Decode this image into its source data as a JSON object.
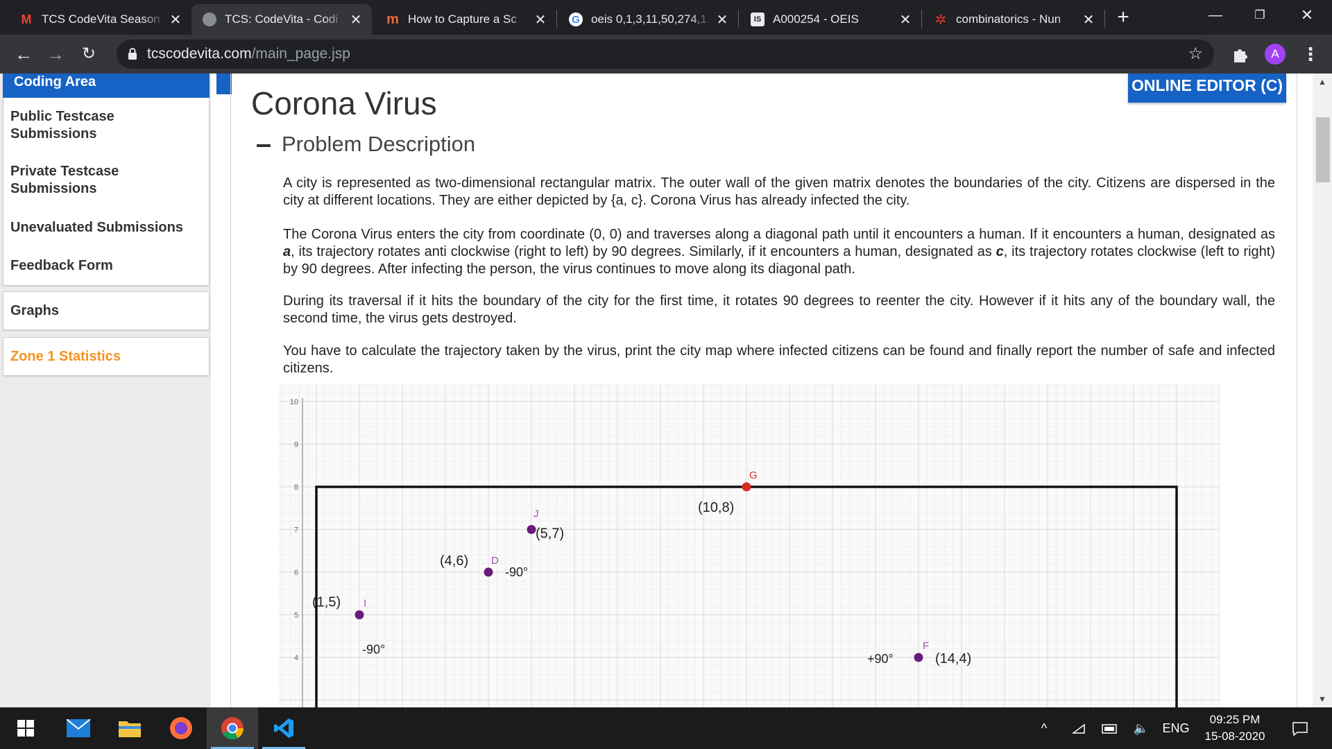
{
  "browser": {
    "tabs": [
      {
        "title": "TCS CodeVita Season",
        "icon": "gmail-icon",
        "active": false
      },
      {
        "title": "TCS: CodeVita - Codi",
        "icon": "globe-icon",
        "active": true
      },
      {
        "title": "How to Capture a Sc",
        "icon": "medium-icon",
        "active": false
      },
      {
        "title": "oeis 0,1,3,11,50,274,1",
        "icon": "google-icon",
        "active": false
      },
      {
        "title": "A000254 - OEIS",
        "icon": "oeis-icon",
        "active": false
      },
      {
        "title": "combinatorics - Nun",
        "icon": "mathse-icon",
        "active": false
      }
    ],
    "url_domain": "tcscodevita.com",
    "url_path": "/main_page.jsp",
    "profile_initial": "A"
  },
  "sidebar": {
    "header": "Coding Area",
    "items": [
      "Public Testcase Submissions",
      "Private Testcase Submissions",
      "Unevaluated Submissions",
      "Feedback Form"
    ],
    "graphs": "Graphs",
    "zone_stats": "Zone 1 Statistics"
  },
  "editor_button": "ONLINE EDITOR (C)",
  "problem": {
    "title": "Corona Virus",
    "section": "Problem Description",
    "p1": "A city is represented as two-dimensional rectangular matrix. The outer wall of the given matrix denotes the boundaries of the city. Citizens are dispersed in the city at different locations. They are either depicted by {a, c}. Corona Virus has already infected the city.",
    "p2_a": "The Corona Virus enters the city from coordinate (0, 0) and traverses along a diagonal path until it encounters a human. If it encounters a human, designated as ",
    "p2_b": "a",
    "p2_c": ", its trajectory rotates anti clockwise (right to left) by 90 degrees. Similarly, if it encounters a human, designated as ",
    "p2_d": "c",
    "p2_e": ", its trajectory rotates clockwise (left to right) by 90 degrees. After infecting the person, the virus continues to move along its diagonal path.",
    "p3": "During its traversal if it hits the boundary of the city for the first time, it rotates 90 degrees to reenter the city. However if it hits any of the boundary wall, the second time, the virus gets destroyed.",
    "p4": "You have to calculate the trajectory taken by the virus, print the city map where infected citizens can be found and finally report the number of safe and infected citizens."
  },
  "chart_data": {
    "type": "scatter",
    "y_ticks": [
      "10",
      "9",
      "8",
      "7",
      "6",
      "5",
      "4"
    ],
    "ylim": [
      3.5,
      10
    ],
    "xlim": [
      -0.5,
      20.5
    ],
    "boundary": {
      "x0": 0,
      "x1": 20,
      "y": 8
    },
    "points": [
      {
        "id": "G",
        "x": 10,
        "y": 8,
        "label": "(10,8)",
        "color": "#d62d20"
      },
      {
        "id": "J",
        "x": 5,
        "y": 7,
        "label": "(5,7)",
        "color": "#6a1b7a"
      },
      {
        "id": "D",
        "x": 4,
        "y": 6,
        "label": "(4,6)",
        "note": "-90°",
        "color": "#6a1b7a"
      },
      {
        "id": "I",
        "x": 1,
        "y": 5,
        "label": "(1,5)",
        "note": "-90°",
        "color": "#6a1b7a"
      },
      {
        "id": "F",
        "x": 14,
        "y": 4,
        "label": "(14,4)",
        "note": "+90°",
        "color": "#6a1b7a"
      }
    ]
  },
  "taskbar": {
    "apps": [
      "windows-start-icon",
      "mail-icon",
      "file-explorer-icon",
      "firefox-icon",
      "chrome-icon",
      "vscode-icon"
    ],
    "lang": "ENG",
    "time": "09:25 PM",
    "date": "15-08-2020"
  }
}
